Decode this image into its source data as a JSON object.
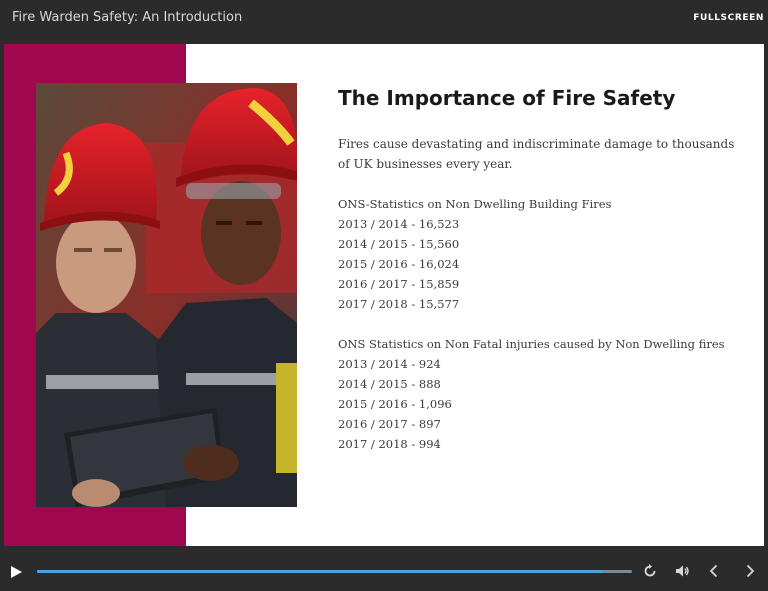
{
  "header": {
    "course_title": "Fire Warden Safety: An Introduction",
    "fullscreen_label": "FULLSCREEN"
  },
  "slide": {
    "accent_color": "#a0074f",
    "heading": "The Importance of Fire Safety",
    "intro": "Fires cause devastating and indiscriminate damage to thousands of UK businesses every year.",
    "groups": [
      {
        "title": "ONS-Statistics on Non Dwelling Building Fires",
        "lines": [
          "2013 / 2014 - 16,523",
          "2014 / 2015 - 15,560",
          "2015 / 2016 - 16,024",
          "2016 / 2017 - 15,859",
          "2017 / 2018 - 15,577"
        ]
      },
      {
        "title": "ONS Statistics on Non Fatal injuries caused by Non Dwelling fires",
        "lines": [
          "2013 / 2014 - 924",
          "2014 / 2015 - 888",
          "2015 / 2016 - 1,096",
          "2016 / 2017 - 897",
          "2017 / 2018 - 994"
        ]
      }
    ]
  },
  "player": {
    "progress_fraction": 0.95,
    "icons": [
      "play-icon",
      "replay-icon",
      "volume-icon",
      "previous-icon",
      "next-icon"
    ],
    "track_color": "#7a8a96",
    "fill_color": "#4aa3df"
  }
}
